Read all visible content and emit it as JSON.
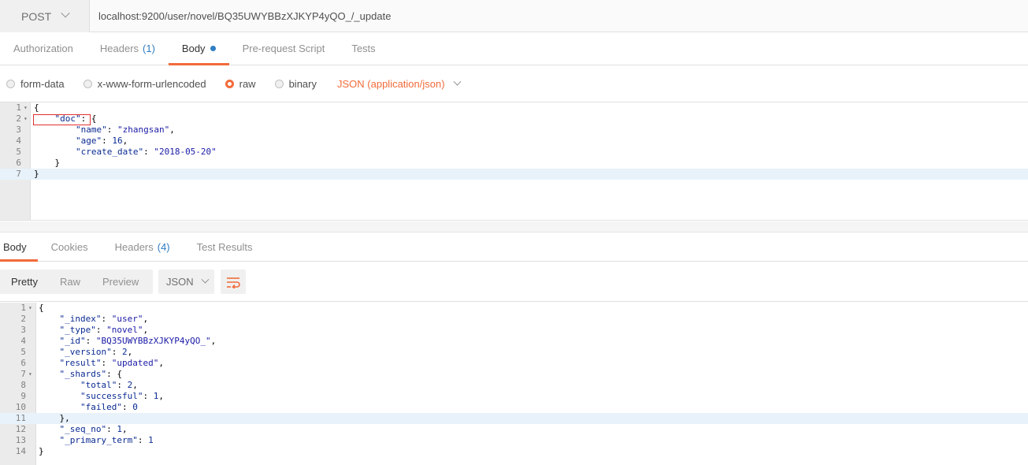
{
  "request": {
    "method": "POST",
    "url": "localhost:9200/user/novel/BQ35UWYBBzXJKYP4yQO_/_update"
  },
  "request_tabs": [
    {
      "label": "Authorization",
      "count": "",
      "active": false
    },
    {
      "label": "Headers",
      "count": "(1)",
      "active": false
    },
    {
      "label": "Body",
      "count": "",
      "active": true
    },
    {
      "label": "Pre-request Script",
      "count": "",
      "active": false
    },
    {
      "label": "Tests",
      "count": "",
      "active": false
    }
  ],
  "body_types": [
    {
      "label": "form-data",
      "checked": false
    },
    {
      "label": "x-www-form-urlencoded",
      "checked": false
    },
    {
      "label": "raw",
      "checked": true
    },
    {
      "label": "binary",
      "checked": false
    }
  ],
  "content_type": "JSON (application/json)",
  "request_body": [
    {
      "num": "1",
      "fold": true,
      "text": "{"
    },
    {
      "num": "2",
      "fold": true,
      "text": "    \"doc\": {"
    },
    {
      "num": "3",
      "fold": false,
      "text": "        \"name\": \"zhangsan\","
    },
    {
      "num": "4",
      "fold": false,
      "text": "        \"age\": 16,"
    },
    {
      "num": "5",
      "fold": false,
      "text": "        \"create_date\": \"2018-05-20\""
    },
    {
      "num": "6",
      "fold": false,
      "text": "    }"
    },
    {
      "num": "7",
      "fold": false,
      "text": "}"
    }
  ],
  "response_tabs": [
    {
      "label": "Body",
      "count": "",
      "active": true
    },
    {
      "label": "Cookies",
      "count": "",
      "active": false
    },
    {
      "label": "Headers",
      "count": "(4)",
      "active": false
    },
    {
      "label": "Test Results",
      "count": "",
      "active": false
    }
  ],
  "view_modes": [
    {
      "label": "Pretty",
      "active": true
    },
    {
      "label": "Raw",
      "active": false
    },
    {
      "label": "Preview",
      "active": false
    }
  ],
  "response_format": "JSON",
  "icons": {
    "wrap": "wrap-lines-icon",
    "chevron": "chevron-down-icon"
  },
  "colors": {
    "accent": "#f26b3a",
    "link": "#2f7dc2"
  },
  "response_body": [
    {
      "num": "1",
      "fold": true,
      "text": "{"
    },
    {
      "num": "2",
      "fold": false,
      "text": "    \"_index\": \"user\","
    },
    {
      "num": "3",
      "fold": false,
      "text": "    \"_type\": \"novel\","
    },
    {
      "num": "4",
      "fold": false,
      "text": "    \"_id\": \"BQ35UWYBBzXJKYP4yQO_\","
    },
    {
      "num": "5",
      "fold": false,
      "text": "    \"_version\": 2,"
    },
    {
      "num": "6",
      "fold": false,
      "text": "    \"result\": \"updated\","
    },
    {
      "num": "7",
      "fold": true,
      "text": "    \"_shards\": {"
    },
    {
      "num": "8",
      "fold": false,
      "text": "        \"total\": 2,"
    },
    {
      "num": "9",
      "fold": false,
      "text": "        \"successful\": 1,"
    },
    {
      "num": "10",
      "fold": false,
      "text": "        \"failed\": 0"
    },
    {
      "num": "11",
      "fold": false,
      "text": "    },"
    },
    {
      "num": "12",
      "fold": false,
      "text": "    \"_seq_no\": 1,"
    },
    {
      "num": "13",
      "fold": false,
      "text": "    \"_primary_term\": 1"
    },
    {
      "num": "14",
      "fold": false,
      "text": "}"
    }
  ]
}
